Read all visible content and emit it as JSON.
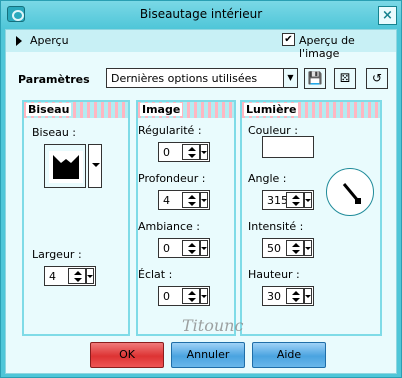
{
  "window": {
    "title": "Biseautage intérieur",
    "close_glyph": "×"
  },
  "preview": {
    "toggle_label": "Aperçu",
    "checkbox_label": "Aperçu de l'image",
    "checkbox_checked": true
  },
  "params": {
    "label": "Paramètres",
    "preset_value": "Dernières options utilisées"
  },
  "toolbar": {
    "save_icon": "save-icon",
    "random_icon": "dice-icon",
    "reset_icon": "reset-icon"
  },
  "groups": {
    "biseau": {
      "title": "Biseau",
      "shape_label": "Biseau :",
      "width_label": "Largeur :",
      "width_value": "4"
    },
    "image": {
      "title": "Image",
      "regularity_label": "Régularité :",
      "regularity_value": "0",
      "depth_label": "Profondeur :",
      "depth_value": "4",
      "ambient_label": "Ambiance :",
      "ambient_value": "0",
      "shine_label": "Éclat :",
      "shine_value": "0"
    },
    "light": {
      "title": "Lumière",
      "color_label": "Couleur :",
      "color_value": "#ffffff",
      "angle_label": "Angle :",
      "angle_value": "315",
      "intensity_label": "Intensité :",
      "intensity_value": "50",
      "height_label": "Hauteur :",
      "height_value": "30"
    }
  },
  "buttons": {
    "ok": "OK",
    "cancel": "Annuler",
    "help": "Aide"
  },
  "watermark": "Titounc",
  "colors": {
    "titlebar": "#4fc6d8",
    "panel": "#e9fbfd",
    "ok": "#dd3333",
    "blue_button": "#4aa3e0"
  }
}
